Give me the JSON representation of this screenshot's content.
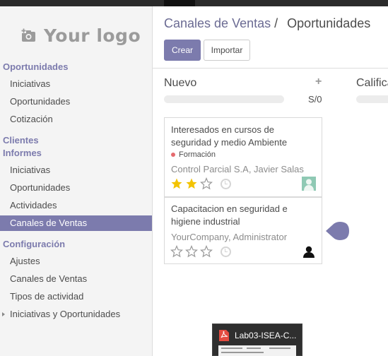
{
  "sidebar": {
    "logo_text": "Your logo",
    "sections": [
      {
        "label": "Oportunidades",
        "items": [
          "Iniciativas",
          "Oportunidades",
          "Cotización"
        ]
      },
      {
        "label": "Clientes"
      },
      {
        "label": "Informes",
        "items": [
          "Iniciativas",
          "Oportunidades",
          "Actividades",
          "Canales de Ventas"
        ]
      },
      {
        "label": "Configuración",
        "items": [
          "Ajustes",
          "Canales de Ventas",
          "Tipos de actividad",
          "Iniciativas y Oportunidades"
        ]
      }
    ],
    "active_item": "Canales de Ventas"
  },
  "breadcrumb": {
    "parent": "Canales de Ventas",
    "separator": "/",
    "current": "Oportunidades"
  },
  "toolbar": {
    "create_label": "Crear",
    "import_label": "Importar"
  },
  "kanban": {
    "columns": [
      {
        "title": "Nuevo",
        "add": "+",
        "count": "S/0"
      },
      {
        "title": "Calificado"
      }
    ],
    "cards": [
      {
        "title": "Interesados en cursos de seguridad y medio Ambiente",
        "tag": "Formación",
        "company": "Control Parcial S.A, Javier Salas",
        "stars_filled": 2,
        "stars_total": 3
      },
      {
        "title": "Capacitacion en seguridad e higiene industrial",
        "company": "YourCompany, Administrator",
        "stars_filled": 0,
        "stars_total": 3
      }
    ]
  },
  "taskbar": {
    "thumb_title": "Lab03-ISEA-C..."
  },
  "colors": {
    "accent": "#7c7bad",
    "star_filled": "#f3c300",
    "tag_dot": "#e56b6f"
  }
}
